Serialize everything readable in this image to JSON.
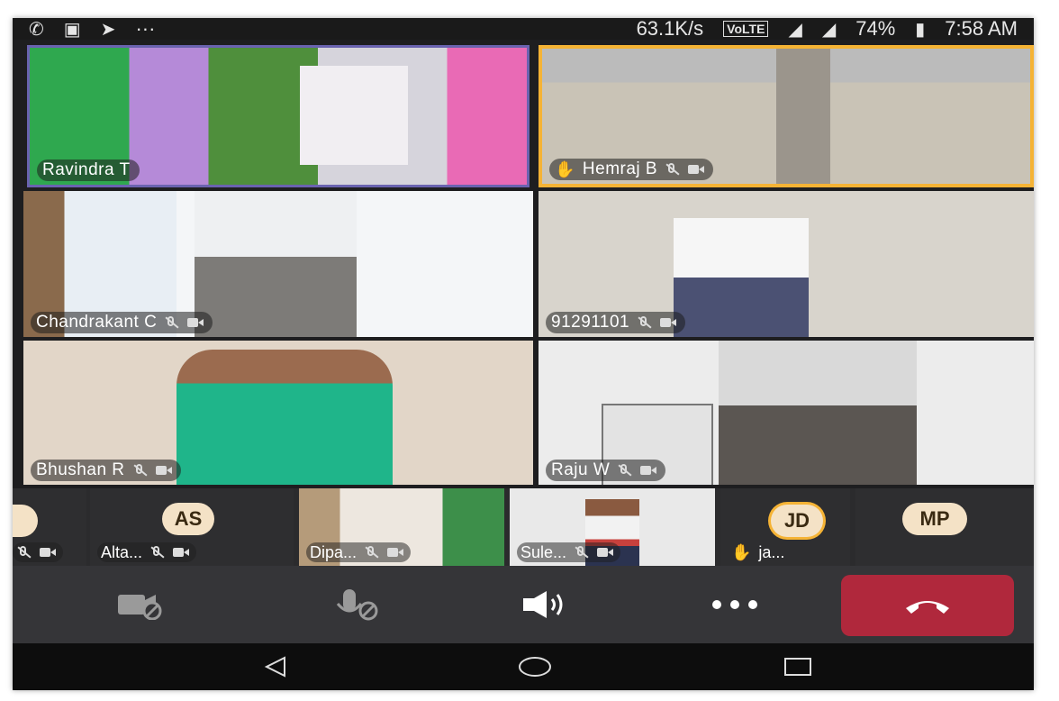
{
  "status_bar": {
    "left_icons": [
      "whatsapp-icon",
      "teams-icon",
      "telegram-icon"
    ],
    "more": "···",
    "speed": "63.1K/s",
    "volte": "VoLTE",
    "battery": "74%",
    "time": "7:58 AM"
  },
  "participants": [
    {
      "name": "Ravindra T",
      "hand": false,
      "muted": false,
      "camoff": false
    },
    {
      "name": "Hemraj B",
      "hand": true,
      "muted": true,
      "camoff": true,
      "active": true
    },
    {
      "name": "Chandrakant C",
      "hand": false,
      "muted": true,
      "camoff": true
    },
    {
      "name": "91291101",
      "hand": false,
      "muted": true,
      "camoff": true
    },
    {
      "name": "Bhushan R",
      "hand": false,
      "muted": true,
      "camoff": true
    },
    {
      "name": "Raju W",
      "hand": false,
      "muted": true,
      "camoff": true
    }
  ],
  "strip": [
    {
      "name": "",
      "initials": ""
    },
    {
      "name": "Alta...",
      "initials": "AS"
    },
    {
      "name": "Dipa...",
      "initials": ""
    },
    {
      "name": "Sule...",
      "initials": ""
    },
    {
      "name": "ja...",
      "initials": "JD",
      "hand": true
    },
    {
      "name": "",
      "initials": "MP"
    }
  ],
  "controls": [
    "camera-off",
    "mic-off",
    "speaker",
    "more",
    "hang-up"
  ],
  "colors": {
    "active_border": "#f5b335",
    "hangup": "#b0283c",
    "avatar_bg": "#f4e2c6"
  }
}
